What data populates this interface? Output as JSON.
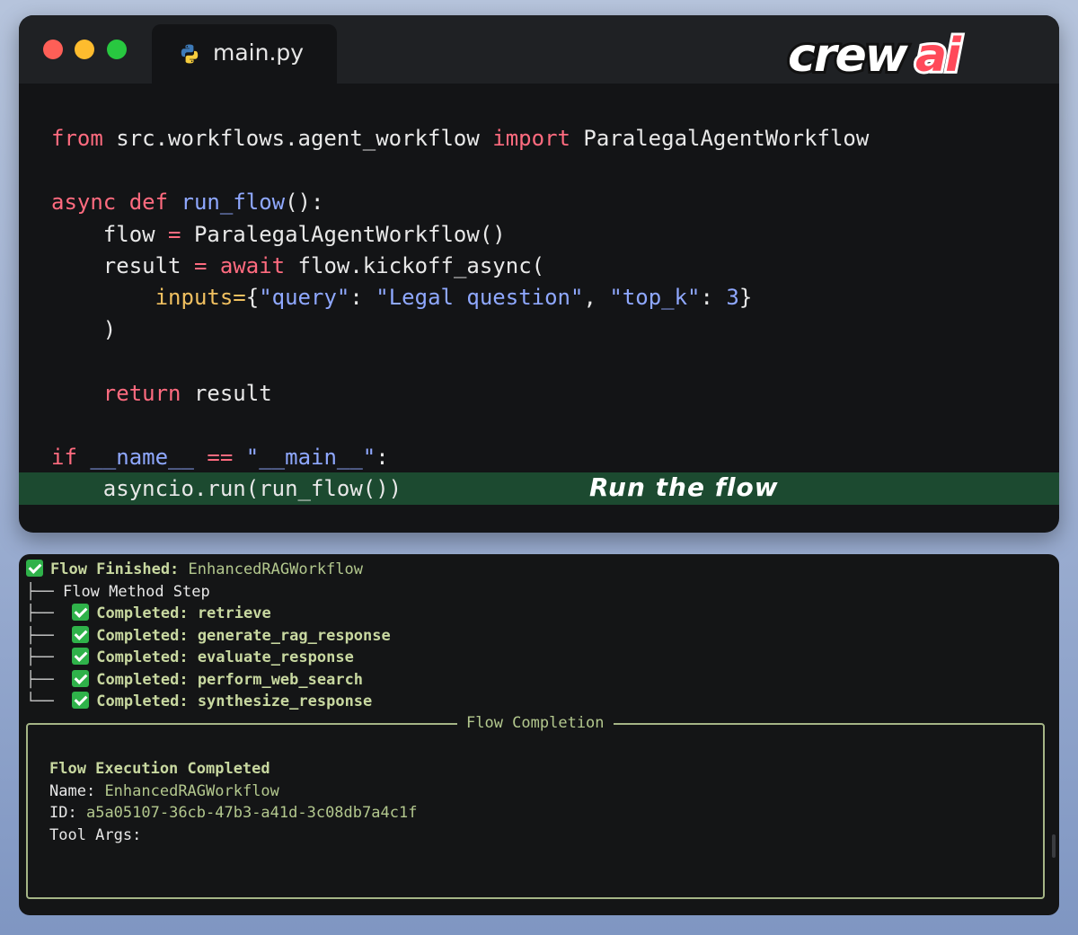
{
  "editor": {
    "tab_label": "main.py",
    "logo_text": "crewai",
    "annotation": "Run the flow",
    "code": {
      "l1": {
        "k1": "from",
        "t1": " src.workflows.agent_workflow ",
        "k2": "import",
        "t2": " ParalegalAgentWorkflow"
      },
      "l2": {
        "k1": "async",
        "sp": " ",
        "k2": "def",
        "sp2": " ",
        "fn": "run_flow",
        "t": "():"
      },
      "l3": {
        "t1": "    flow ",
        "op": "=",
        "t2": " ParalegalAgentWorkflow()"
      },
      "l4": {
        "t1": "    result ",
        "op": "=",
        "sp": " ",
        "k": "await",
        "t2": " flow.kickoff_async("
      },
      "l5": {
        "ind": "        ",
        "p": "inputs=",
        "b1": "{",
        "s1": "\"query\"",
        "c1": ": ",
        "s2": "\"Legal question\"",
        "c2": ", ",
        "s3": "\"top_k\"",
        "c3": ": ",
        "n": "3",
        "b2": "}"
      },
      "l6": {
        "t": "    )"
      },
      "l7": {
        "ind": "    ",
        "k": "return",
        "t": " result"
      },
      "l8": {
        "k": "if",
        "sp": " ",
        "v": "__name__",
        "sp2": " ",
        "op": "==",
        "sp3": " ",
        "s": "\"__main__\"",
        "t": ":"
      },
      "l9": {
        "t": "    asyncio.run(run_flow())"
      }
    }
  },
  "terminal": {
    "header_label": "Flow Finished:",
    "header_value": " EnhancedRAGWorkflow",
    "tree_root": "Flow Method Step",
    "branch": "├──",
    "branch_last": "└──",
    "step_label": "Completed:",
    "steps": [
      "retrieve",
      "generate_rag_response",
      "evaluate_response",
      "perform_web_search",
      "synthesize_response"
    ],
    "box_title": "Flow Completion",
    "completed_title": "Flow Execution Completed",
    "name_label": "Name:",
    "name_value": "EnhancedRAGWorkflow",
    "id_label": "ID:",
    "id_value": "a5a05107-36cb-47b3-a41d-3c08db7a4c1f",
    "tool_args_label": "Tool Args:"
  },
  "colors": {
    "keyword": "#ff6b7f",
    "function": "#8fa8ff",
    "param": "#f0c060",
    "highlight": "#1c4a30",
    "check": "#2fb24a",
    "terminal_green": "#b3c88e"
  }
}
